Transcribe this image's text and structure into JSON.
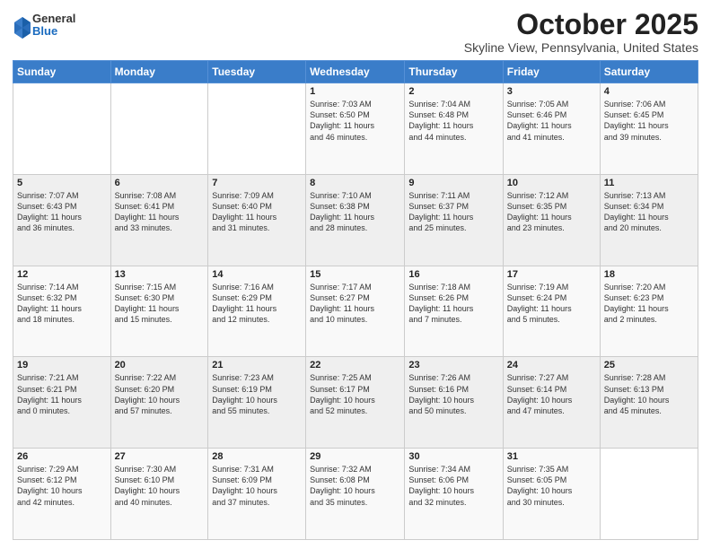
{
  "header": {
    "logo_general": "General",
    "logo_blue": "Blue",
    "month_title": "October 2025",
    "subtitle": "Skyline View, Pennsylvania, United States"
  },
  "days_of_week": [
    "Sunday",
    "Monday",
    "Tuesday",
    "Wednesday",
    "Thursday",
    "Friday",
    "Saturday"
  ],
  "weeks": [
    [
      {
        "day": "",
        "content": ""
      },
      {
        "day": "",
        "content": ""
      },
      {
        "day": "",
        "content": ""
      },
      {
        "day": "1",
        "content": "Sunrise: 7:03 AM\nSunset: 6:50 PM\nDaylight: 11 hours\nand 46 minutes."
      },
      {
        "day": "2",
        "content": "Sunrise: 7:04 AM\nSunset: 6:48 PM\nDaylight: 11 hours\nand 44 minutes."
      },
      {
        "day": "3",
        "content": "Sunrise: 7:05 AM\nSunset: 6:46 PM\nDaylight: 11 hours\nand 41 minutes."
      },
      {
        "day": "4",
        "content": "Sunrise: 7:06 AM\nSunset: 6:45 PM\nDaylight: 11 hours\nand 39 minutes."
      }
    ],
    [
      {
        "day": "5",
        "content": "Sunrise: 7:07 AM\nSunset: 6:43 PM\nDaylight: 11 hours\nand 36 minutes."
      },
      {
        "day": "6",
        "content": "Sunrise: 7:08 AM\nSunset: 6:41 PM\nDaylight: 11 hours\nand 33 minutes."
      },
      {
        "day": "7",
        "content": "Sunrise: 7:09 AM\nSunset: 6:40 PM\nDaylight: 11 hours\nand 31 minutes."
      },
      {
        "day": "8",
        "content": "Sunrise: 7:10 AM\nSunset: 6:38 PM\nDaylight: 11 hours\nand 28 minutes."
      },
      {
        "day": "9",
        "content": "Sunrise: 7:11 AM\nSunset: 6:37 PM\nDaylight: 11 hours\nand 25 minutes."
      },
      {
        "day": "10",
        "content": "Sunrise: 7:12 AM\nSunset: 6:35 PM\nDaylight: 11 hours\nand 23 minutes."
      },
      {
        "day": "11",
        "content": "Sunrise: 7:13 AM\nSunset: 6:34 PM\nDaylight: 11 hours\nand 20 minutes."
      }
    ],
    [
      {
        "day": "12",
        "content": "Sunrise: 7:14 AM\nSunset: 6:32 PM\nDaylight: 11 hours\nand 18 minutes."
      },
      {
        "day": "13",
        "content": "Sunrise: 7:15 AM\nSunset: 6:30 PM\nDaylight: 11 hours\nand 15 minutes."
      },
      {
        "day": "14",
        "content": "Sunrise: 7:16 AM\nSunset: 6:29 PM\nDaylight: 11 hours\nand 12 minutes."
      },
      {
        "day": "15",
        "content": "Sunrise: 7:17 AM\nSunset: 6:27 PM\nDaylight: 11 hours\nand 10 minutes."
      },
      {
        "day": "16",
        "content": "Sunrise: 7:18 AM\nSunset: 6:26 PM\nDaylight: 11 hours\nand 7 minutes."
      },
      {
        "day": "17",
        "content": "Sunrise: 7:19 AM\nSunset: 6:24 PM\nDaylight: 11 hours\nand 5 minutes."
      },
      {
        "day": "18",
        "content": "Sunrise: 7:20 AM\nSunset: 6:23 PM\nDaylight: 11 hours\nand 2 minutes."
      }
    ],
    [
      {
        "day": "19",
        "content": "Sunrise: 7:21 AM\nSunset: 6:21 PM\nDaylight: 11 hours\nand 0 minutes."
      },
      {
        "day": "20",
        "content": "Sunrise: 7:22 AM\nSunset: 6:20 PM\nDaylight: 10 hours\nand 57 minutes."
      },
      {
        "day": "21",
        "content": "Sunrise: 7:23 AM\nSunset: 6:19 PM\nDaylight: 10 hours\nand 55 minutes."
      },
      {
        "day": "22",
        "content": "Sunrise: 7:25 AM\nSunset: 6:17 PM\nDaylight: 10 hours\nand 52 minutes."
      },
      {
        "day": "23",
        "content": "Sunrise: 7:26 AM\nSunset: 6:16 PM\nDaylight: 10 hours\nand 50 minutes."
      },
      {
        "day": "24",
        "content": "Sunrise: 7:27 AM\nSunset: 6:14 PM\nDaylight: 10 hours\nand 47 minutes."
      },
      {
        "day": "25",
        "content": "Sunrise: 7:28 AM\nSunset: 6:13 PM\nDaylight: 10 hours\nand 45 minutes."
      }
    ],
    [
      {
        "day": "26",
        "content": "Sunrise: 7:29 AM\nSunset: 6:12 PM\nDaylight: 10 hours\nand 42 minutes."
      },
      {
        "day": "27",
        "content": "Sunrise: 7:30 AM\nSunset: 6:10 PM\nDaylight: 10 hours\nand 40 minutes."
      },
      {
        "day": "28",
        "content": "Sunrise: 7:31 AM\nSunset: 6:09 PM\nDaylight: 10 hours\nand 37 minutes."
      },
      {
        "day": "29",
        "content": "Sunrise: 7:32 AM\nSunset: 6:08 PM\nDaylight: 10 hours\nand 35 minutes."
      },
      {
        "day": "30",
        "content": "Sunrise: 7:34 AM\nSunset: 6:06 PM\nDaylight: 10 hours\nand 32 minutes."
      },
      {
        "day": "31",
        "content": "Sunrise: 7:35 AM\nSunset: 6:05 PM\nDaylight: 10 hours\nand 30 minutes."
      },
      {
        "day": "",
        "content": ""
      }
    ]
  ]
}
